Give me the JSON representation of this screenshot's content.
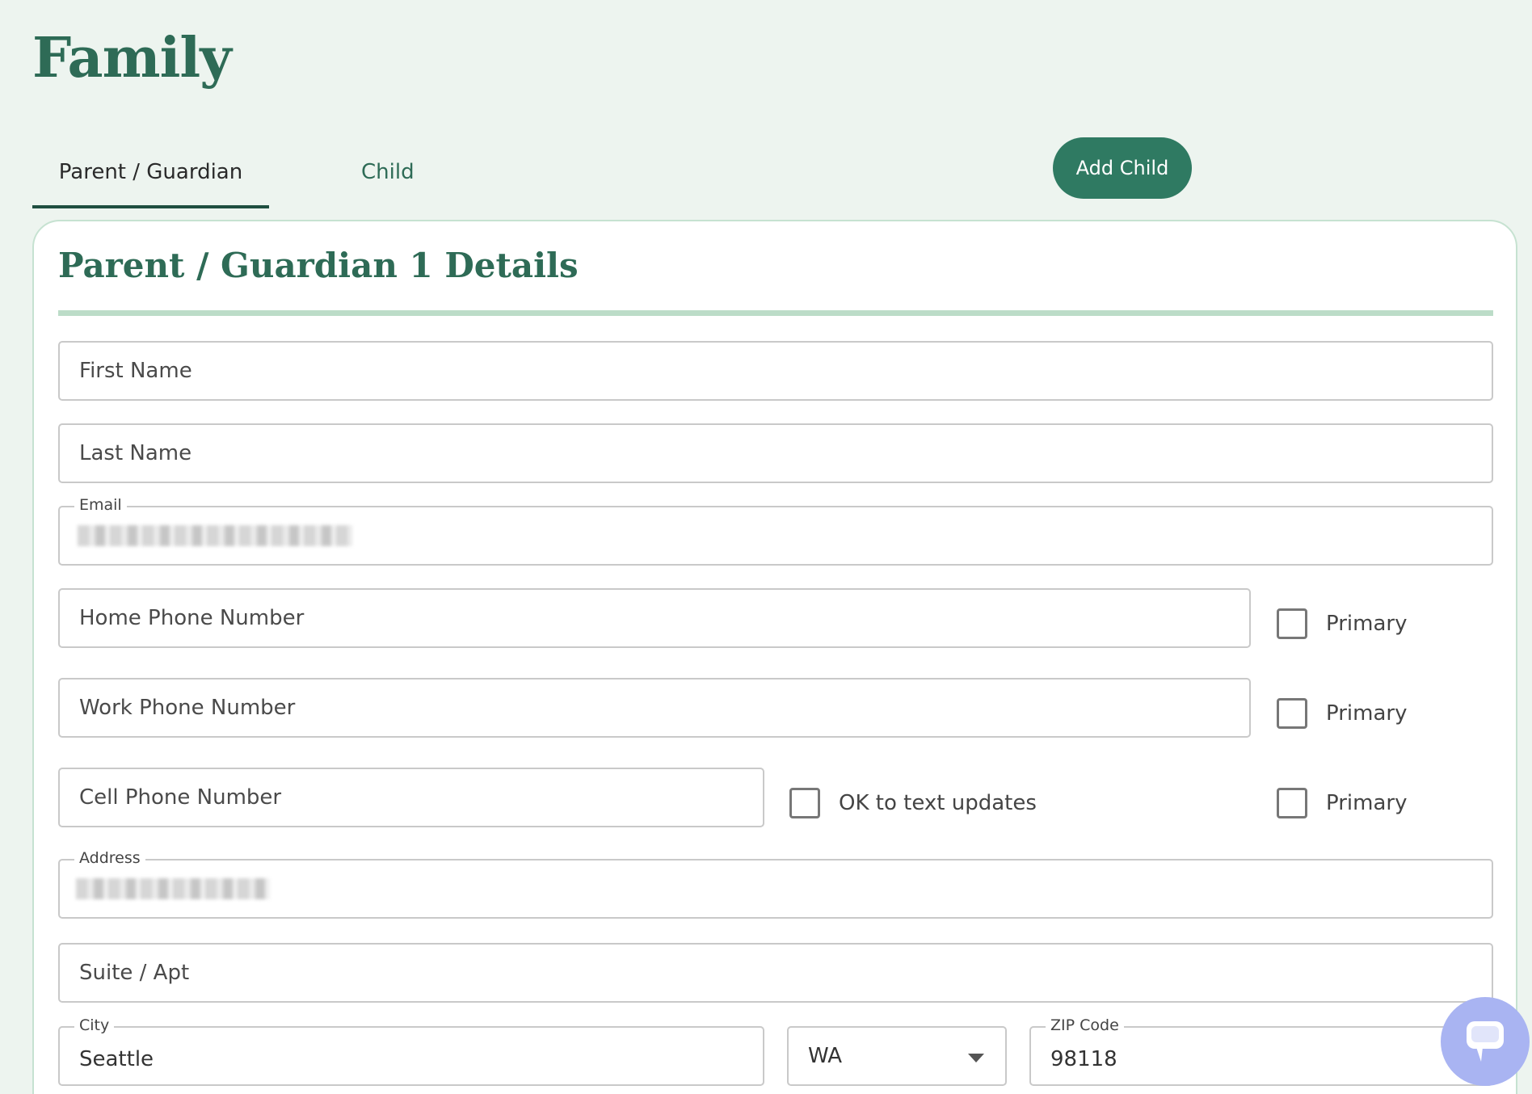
{
  "page": {
    "title": "Family"
  },
  "tabs": [
    {
      "label": "Parent / Guardian",
      "active": true
    },
    {
      "label": "Child",
      "active": false
    }
  ],
  "actions": {
    "add_child_label": "Add Child"
  },
  "card": {
    "title": "Parent / Guardian 1 Details",
    "fields": {
      "first_name": {
        "placeholder": "First Name",
        "value": ""
      },
      "last_name": {
        "placeholder": "Last Name",
        "value": ""
      },
      "email": {
        "label": "Email",
        "value": ""
      },
      "home_phone": {
        "placeholder": "Home Phone Number",
        "value": ""
      },
      "work_phone": {
        "placeholder": "Work Phone Number",
        "value": ""
      },
      "cell_phone": {
        "placeholder": "Cell Phone Number",
        "value": ""
      },
      "address": {
        "label": "Address",
        "value": ""
      },
      "suite": {
        "placeholder": "Suite / Apt",
        "value": ""
      },
      "city": {
        "label": "City",
        "value": "Seattle"
      },
      "state": {
        "value": "WA"
      },
      "zip": {
        "label": "ZIP Code",
        "value": "98118"
      }
    },
    "checkboxes": {
      "home_primary": {
        "label": "Primary",
        "checked": false
      },
      "work_primary": {
        "label": "Primary",
        "checked": false
      },
      "cell_ok_text": {
        "label": "OK to text updates",
        "checked": false
      },
      "cell_primary": {
        "label": "Primary",
        "checked": false
      }
    }
  },
  "chat": {
    "icon": "chat-bubble-icon",
    "color": "#a9b4f2"
  },
  "colors": {
    "brand": "#2e6b56",
    "button": "#2f7a62",
    "background": "#edf4ef",
    "rule": "#bcdcc8"
  }
}
